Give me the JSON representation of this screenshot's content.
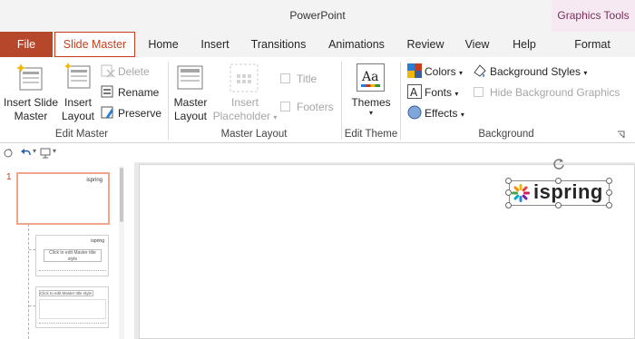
{
  "app": {
    "title": "PowerPoint"
  },
  "contextual": {
    "label": "Graphics Tools",
    "tab": "Format",
    "color": "#7b2d5c"
  },
  "tabs": {
    "file": "File",
    "slide_master": "Slide Master",
    "home": "Home",
    "insert": "Insert",
    "transitions": "Transitions",
    "animations": "Animations",
    "review": "Review",
    "view": "View",
    "help": "Help"
  },
  "ribbon": {
    "edit_master": {
      "insert_slide_master": [
        "Insert Slide",
        "Master"
      ],
      "insert_layout": [
        "Insert",
        "Layout"
      ],
      "delete": "Delete",
      "rename": "Rename",
      "preserve": "Preserve",
      "group_label": "Edit Master"
    },
    "master_layout": {
      "master_layout": [
        "Master",
        "Layout"
      ],
      "insert_placeholder": [
        "Insert",
        "Placeholder"
      ],
      "title": "Title",
      "footers": "Footers",
      "group_label": "Master Layout"
    },
    "edit_theme": {
      "themes": "Themes",
      "themes_glyph": "Aa",
      "group_label": "Edit Theme"
    },
    "background": {
      "colors": "Colors",
      "fonts": "Fonts",
      "effects": "Effects",
      "background_styles": "Background Styles",
      "hide_background_graphics": "Hide Background Graphics",
      "group_label": "Background"
    }
  },
  "thumbnails": {
    "slide_number": "1",
    "logo_text": "ispring",
    "layout1_title": "Click to edit Master title style",
    "layout2_title": "Click to edit Master title style"
  },
  "canvas": {
    "logo_text": "ispring"
  },
  "colors": {
    "accent": "#b7472a",
    "file_tab": "#b7472a",
    "contextual_bg": "#f6e9f1"
  }
}
